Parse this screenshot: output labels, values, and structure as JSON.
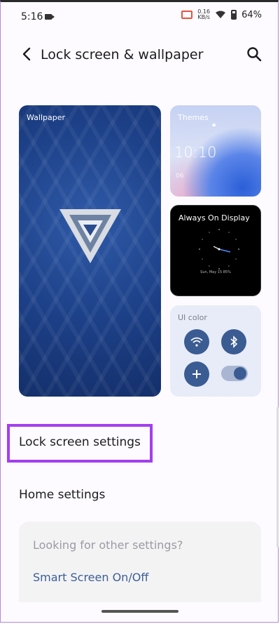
{
  "status_bar": {
    "time": "5:16",
    "speed_value": "0.16",
    "speed_unit": "KB/s",
    "battery": "64%"
  },
  "header": {
    "title": "Lock screen & wallpaper"
  },
  "cards": {
    "wallpaper": {
      "label": "Wallpaper"
    },
    "themes": {
      "label": "Themes",
      "clock": "10:10",
      "date": "06"
    },
    "aod": {
      "label": "Always On Display",
      "date": "Sun, May 15  85%"
    },
    "ui_color": {
      "label": "UI color"
    }
  },
  "menu": {
    "lock_screen_settings": "Lock screen settings",
    "home_settings": "Home settings"
  },
  "suggestions": {
    "hint": "Looking for other settings?",
    "link": "Smart Screen On/Off"
  },
  "colors": {
    "accent": "#3b5b93",
    "highlight": "#a43ef0",
    "link": "#3a5f95"
  }
}
